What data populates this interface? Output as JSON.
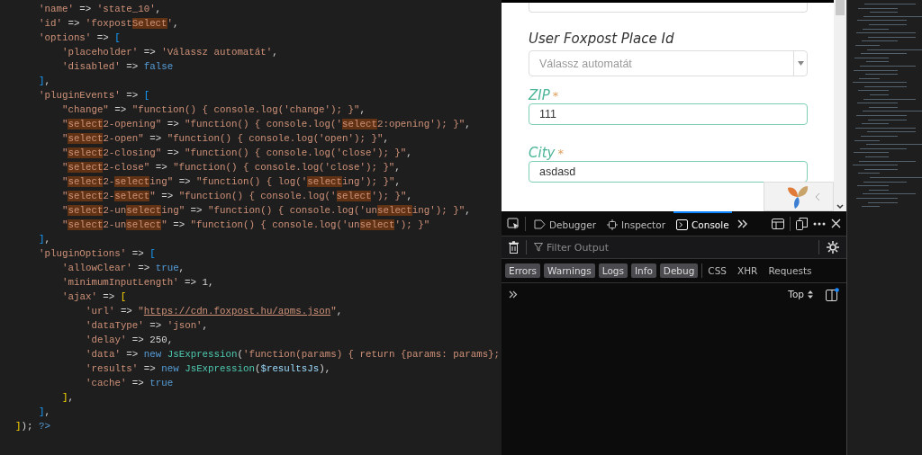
{
  "editor": {
    "lines": [
      {
        "children": [
          {
            "tokens": [
              {
                "t": "'name'",
                "kind": "s"
              },
              {
                "t": " => ",
                "kind": "p"
              },
              {
                "t": "'state_10'",
                "kind": "s"
              },
              {
                "t": ",",
                "kind": "p"
              }
            ]
          },
          {
            "tokens": [
              {
                "t": "'id'",
                "kind": "s"
              },
              {
                "t": " => ",
                "kind": "p"
              },
              {
                "t": "'foxpost",
                "kind": "s"
              },
              {
                "t": "Select",
                "kind": "m"
              },
              {
                "t": "'",
                "kind": "s"
              },
              {
                "t": ",",
                "kind": "p"
              }
            ]
          },
          {
            "tokens": [
              {
                "t": "'options'",
                "kind": "s"
              },
              {
                "t": " => ",
                "kind": "p"
              },
              {
                "t": "[",
                "kind": "b1"
              }
            ],
            "children": [
              {
                "tokens": [
                  {
                    "t": "'placeholder'",
                    "kind": "s"
                  },
                  {
                    "t": " => ",
                    "kind": "p"
                  },
                  {
                    "t": "'Válassz automatát'",
                    "kind": "s"
                  },
                  {
                    "t": ",",
                    "kind": "p"
                  }
                ]
              },
              {
                "tokens": [
                  {
                    "t": "'disabled'",
                    "kind": "s"
                  },
                  {
                    "t": " => ",
                    "kind": "p"
                  },
                  {
                    "t": "false",
                    "kind": "k"
                  }
                ]
              }
            ]
          },
          {
            "tokens": [
              {
                "t": "]",
                "kind": "b1"
              },
              {
                "t": ",",
                "kind": "p"
              }
            ]
          },
          {
            "tokens": [
              {
                "t": "'pluginEvents'",
                "kind": "s"
              },
              {
                "t": " => ",
                "kind": "p"
              },
              {
                "t": "[",
                "kind": "b1"
              }
            ],
            "children": [
              {
                "tokens": [
                  {
                    "t": "\"change\"",
                    "kind": "s"
                  },
                  {
                    "t": " => ",
                    "kind": "p"
                  },
                  {
                    "t": "\"function() { console.log('change'); }\"",
                    "kind": "s"
                  },
                  {
                    "t": ",",
                    "kind": "p"
                  }
                ]
              },
              {
                "tokens": [
                  {
                    "t": "\"",
                    "kind": "s"
                  },
                  {
                    "t": "select",
                    "kind": "m"
                  },
                  {
                    "t": "2-opening\"",
                    "kind": "s"
                  },
                  {
                    "t": " => ",
                    "kind": "p"
                  },
                  {
                    "t": "\"function() { console.log('",
                    "kind": "s"
                  },
                  {
                    "t": "select",
                    "kind": "m"
                  },
                  {
                    "t": "2:opening'); }\"",
                    "kind": "s"
                  },
                  {
                    "t": ",",
                    "kind": "p"
                  }
                ]
              },
              {
                "tokens": [
                  {
                    "t": "\"",
                    "kind": "s"
                  },
                  {
                    "t": "select",
                    "kind": "m"
                  },
                  {
                    "t": "2-open\"",
                    "kind": "s"
                  },
                  {
                    "t": " => ",
                    "kind": "p"
                  },
                  {
                    "t": "\"function() { console.log('open'); }\"",
                    "kind": "s"
                  },
                  {
                    "t": ",",
                    "kind": "p"
                  }
                ]
              },
              {
                "tokens": [
                  {
                    "t": "\"",
                    "kind": "s"
                  },
                  {
                    "t": "select",
                    "kind": "m"
                  },
                  {
                    "t": "2-closing\"",
                    "kind": "s"
                  },
                  {
                    "t": " => ",
                    "kind": "p"
                  },
                  {
                    "t": "\"function() { console.log('close'); }\"",
                    "kind": "s"
                  },
                  {
                    "t": ",",
                    "kind": "p"
                  }
                ]
              },
              {
                "tokens": [
                  {
                    "t": "\"",
                    "kind": "s"
                  },
                  {
                    "t": "select",
                    "kind": "m"
                  },
                  {
                    "t": "2-close\"",
                    "kind": "s"
                  },
                  {
                    "t": " => ",
                    "kind": "p"
                  },
                  {
                    "t": "\"function() { console.log('close'); }\"",
                    "kind": "s"
                  },
                  {
                    "t": ",",
                    "kind": "p"
                  }
                ]
              },
              {
                "tokens": [
                  {
                    "t": "\"",
                    "kind": "s"
                  },
                  {
                    "t": "select",
                    "kind": "m"
                  },
                  {
                    "t": "2-",
                    "kind": "s"
                  },
                  {
                    "t": "select",
                    "kind": "m"
                  },
                  {
                    "t": "ing\"",
                    "kind": "s"
                  },
                  {
                    "t": " => ",
                    "kind": "p"
                  },
                  {
                    "t": "\"function() { log('",
                    "kind": "s"
                  },
                  {
                    "t": "select",
                    "kind": "m"
                  },
                  {
                    "t": "ing'); }\"",
                    "kind": "s"
                  },
                  {
                    "t": ",",
                    "kind": "p"
                  }
                ]
              },
              {
                "tokens": [
                  {
                    "t": "\"",
                    "kind": "s"
                  },
                  {
                    "t": "select",
                    "kind": "m"
                  },
                  {
                    "t": "2-",
                    "kind": "s"
                  },
                  {
                    "t": "select",
                    "kind": "m"
                  },
                  {
                    "t": "\"",
                    "kind": "s"
                  },
                  {
                    "t": " => ",
                    "kind": "p"
                  },
                  {
                    "t": "\"function() { console.log('",
                    "kind": "s"
                  },
                  {
                    "t": "select",
                    "kind": "m"
                  },
                  {
                    "t": "'); }\"",
                    "kind": "s"
                  },
                  {
                    "t": ",",
                    "kind": "p"
                  }
                ]
              },
              {
                "tokens": [
                  {
                    "t": "\"",
                    "kind": "s"
                  },
                  {
                    "t": "select",
                    "kind": "m"
                  },
                  {
                    "t": "2-un",
                    "kind": "s"
                  },
                  {
                    "t": "select",
                    "kind": "m"
                  },
                  {
                    "t": "ing\"",
                    "kind": "s"
                  },
                  {
                    "t": " => ",
                    "kind": "p"
                  },
                  {
                    "t": "\"function() { console.log('un",
                    "kind": "s"
                  },
                  {
                    "t": "select",
                    "kind": "m"
                  },
                  {
                    "t": "ing'); }\"",
                    "kind": "s"
                  },
                  {
                    "t": ",",
                    "kind": "p"
                  }
                ]
              },
              {
                "tokens": [
                  {
                    "t": "\"",
                    "kind": "s"
                  },
                  {
                    "t": "select",
                    "kind": "m"
                  },
                  {
                    "t": "2-un",
                    "kind": "s"
                  },
                  {
                    "t": "select",
                    "kind": "m"
                  },
                  {
                    "t": "\"",
                    "kind": "s"
                  },
                  {
                    "t": " => ",
                    "kind": "p"
                  },
                  {
                    "t": "\"function() { console.log('un",
                    "kind": "s"
                  },
                  {
                    "t": "select",
                    "kind": "m"
                  },
                  {
                    "t": "'); }\"",
                    "kind": "s"
                  }
                ]
              }
            ]
          },
          {
            "tokens": [
              {
                "t": "]",
                "kind": "b1"
              },
              {
                "t": ",",
                "kind": "p"
              }
            ]
          },
          {
            "tokens": [
              {
                "t": "'pluginOptions'",
                "kind": "s"
              },
              {
                "t": " => ",
                "kind": "p"
              },
              {
                "t": "[",
                "kind": "b1"
              }
            ],
            "children": [
              {
                "tokens": [
                  {
                    "t": "'allowClear'",
                    "kind": "s"
                  },
                  {
                    "t": " => ",
                    "kind": "p"
                  },
                  {
                    "t": "true",
                    "kind": "k"
                  },
                  {
                    "t": ",",
                    "kind": "p"
                  }
                ]
              },
              {
                "tokens": [
                  {
                    "t": "'minimumInputLength'",
                    "kind": "s"
                  },
                  {
                    "t": " => 1,",
                    "kind": "p"
                  }
                ]
              },
              {
                "tokens": [
                  {
                    "t": "'ajax'",
                    "kind": "s"
                  },
                  {
                    "t": " => ",
                    "kind": "p"
                  },
                  {
                    "t": "[",
                    "kind": "b2"
                  }
                ],
                "children": [
                  {
                    "tokens": [
                      {
                        "t": "'url'",
                        "kind": "s"
                      },
                      {
                        "t": " => ",
                        "kind": "p"
                      },
                      {
                        "t": "\"",
                        "kind": "s"
                      },
                      {
                        "t": "https://cdn.foxpost.hu/apms.json",
                        "kind": "u"
                      },
                      {
                        "t": "\"",
                        "kind": "s"
                      },
                      {
                        "t": ",",
                        "kind": "p"
                      }
                    ]
                  },
                  {
                    "tokens": [
                      {
                        "t": "'dataType'",
                        "kind": "s"
                      },
                      {
                        "t": " => ",
                        "kind": "p"
                      },
                      {
                        "t": "'json'",
                        "kind": "s"
                      },
                      {
                        "t": ",",
                        "kind": "p"
                      }
                    ]
                  },
                  {
                    "tokens": [
                      {
                        "t": "'delay'",
                        "kind": "s"
                      },
                      {
                        "t": " => 250,",
                        "kind": "p"
                      }
                    ]
                  },
                  {
                    "tokens": [
                      {
                        "t": "'data'",
                        "kind": "s"
                      },
                      {
                        "t": " => ",
                        "kind": "p"
                      },
                      {
                        "t": "new ",
                        "kind": "k"
                      },
                      {
                        "t": "JsExpression",
                        "kind": "c"
                      },
                      {
                        "t": "(",
                        "kind": "p"
                      },
                      {
                        "t": "'function(params) { return {params: params};",
                        "kind": "s"
                      }
                    ]
                  },
                  {
                    "tokens": [
                      {
                        "t": "'results'",
                        "kind": "s"
                      },
                      {
                        "t": " => ",
                        "kind": "p"
                      },
                      {
                        "t": "new ",
                        "kind": "k"
                      },
                      {
                        "t": "JsExpression",
                        "kind": "c"
                      },
                      {
                        "t": "(",
                        "kind": "p"
                      },
                      {
                        "t": "$resultsJs",
                        "kind": "v"
                      },
                      {
                        "t": "),",
                        "kind": "p"
                      }
                    ]
                  },
                  {
                    "tokens": [
                      {
                        "t": "'cache'",
                        "kind": "s"
                      },
                      {
                        "t": " => ",
                        "kind": "p"
                      },
                      {
                        "t": "true",
                        "kind": "k"
                      }
                    ]
                  }
                ]
              },
              {
                "tokens": [
                  {
                    "t": "]",
                    "kind": "b2"
                  },
                  {
                    "t": ",",
                    "kind": "p"
                  }
                ]
              }
            ]
          },
          {
            "tokens": [
              {
                "t": "]",
                "kind": "b1"
              },
              {
                "t": ",",
                "kind": "p"
              }
            ]
          }
        ]
      },
      {
        "tokens": [
          {
            "t": "]",
            "kind": "b2"
          },
          {
            "t": "); ",
            "kind": "p"
          },
          {
            "t": "?>",
            "kind": "k"
          }
        ]
      }
    ]
  },
  "page": {
    "fields": [
      {
        "kind": "select",
        "label": "User Foxpost Place Id",
        "placeholder": "Válassz automatát"
      },
      {
        "kind": "text",
        "label": "ZIP",
        "required_mark": "*",
        "value": "111"
      },
      {
        "kind": "text",
        "label": "City",
        "required_mark": "*",
        "value": "asdasd"
      }
    ]
  },
  "devtools": {
    "tabs": [
      {
        "label": "Debugger",
        "selected": false
      },
      {
        "label": "Inspector",
        "selected": false
      },
      {
        "label": "Console",
        "selected": true
      }
    ],
    "filter": {
      "placeholder": "Filter Output"
    },
    "filters": [
      {
        "label": "Errors",
        "on": true
      },
      {
        "label": "Warnings",
        "on": true
      },
      {
        "label": "Logs",
        "on": true
      },
      {
        "label": "Info",
        "on": true
      },
      {
        "label": "Debug",
        "on": true
      },
      {
        "label": "CSS",
        "on": false
      },
      {
        "label": "XHR",
        "on": false
      },
      {
        "label": "Requests",
        "on": false
      }
    ],
    "context": "Top"
  }
}
